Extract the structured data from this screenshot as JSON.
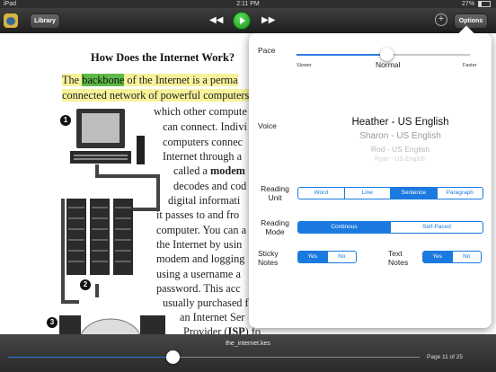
{
  "status": {
    "device": "iPad",
    "wifi": "wifi-icon",
    "time": "2:11 PM",
    "battery": "27%"
  },
  "toolbar": {
    "library": "Library",
    "options": "Options"
  },
  "page": {
    "title": "How Does the Internet Work?",
    "highlight_word": "backbone",
    "line1_before": "The ",
    "line1_after": " of the Internet is a perma",
    "line2": "connected network of powerful computers",
    "lines": [
      "which other compute",
      "can connect. Indivi",
      "computers connec",
      "Internet through a",
      "called a ",
      "decodes and cod",
      "digital informati",
      "it passes to and fro",
      "computer. You can a",
      "the Internet by usin",
      "modem and logging",
      "using a username a",
      "password. This acc",
      "usually purchased f",
      "an Internet Ser",
      "Provider ("
    ],
    "modem": "modem",
    "isp": "ISP",
    "isp_after": ") fo",
    "markers": [
      "1",
      "2",
      "3"
    ]
  },
  "options": {
    "pace_label": "Pace",
    "pace_slower": "Slower",
    "pace_normal": "Normal",
    "pace_faster": "Faster",
    "pace_value": 0.52,
    "voice_label": "Voice",
    "voices": [
      "Heather - US English",
      "Sharon - US English",
      "Rod - US English",
      "Ryan - US English"
    ],
    "reading_unit_label": "Reading Unit",
    "reading_unit_options": [
      "Word",
      "Line",
      "Sentence",
      "Paragraph"
    ],
    "reading_unit_selected": "Sentence",
    "reading_mode_label": "Reading Mode",
    "reading_mode_options": [
      "Continous",
      "Self-Paced"
    ],
    "reading_mode_selected": "Continous",
    "sticky_notes_label": "Sticky Notes",
    "sticky_options": [
      "Yes",
      "No"
    ],
    "sticky_selected": "Yes",
    "text_notes_label": "Text Notes",
    "text_options": [
      "Yes",
      "No"
    ],
    "text_selected": "Yes"
  },
  "footer": {
    "filename": "the_internet.kes",
    "page_indicator": "Page 11 of 25",
    "progress": 0.4
  }
}
